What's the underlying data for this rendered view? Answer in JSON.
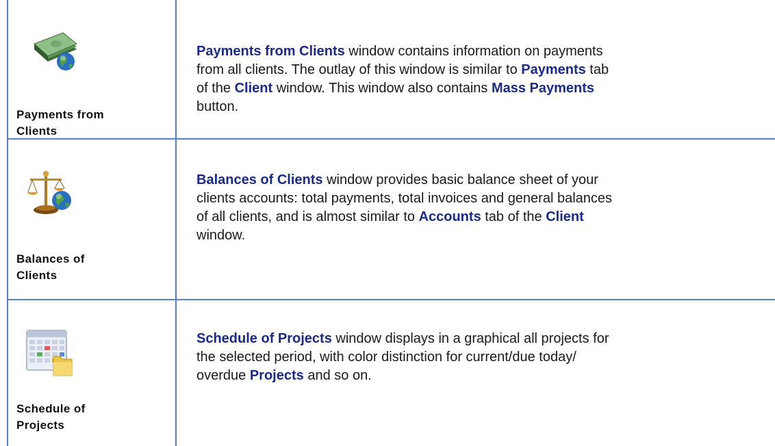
{
  "rows": [
    {
      "label_line1": "Payments from",
      "label_line2": "Clients",
      "icon": "money-globe-icon",
      "desc": {
        "t1": "Payments from Clients",
        "t2": " window contains information on payments",
        "t3": "from all clients. The outlay of this window is similar to ",
        "t4": "Payments",
        "t5": " tab",
        "t6": "of the ",
        "t7": "Client",
        "t8": " window. This window also contains ",
        "t9": "Mass Payments",
        "t10": "button."
      }
    },
    {
      "label_line1": "Balances of",
      "label_line2": "Clients",
      "icon": "scales-globe-icon",
      "desc": {
        "t1": "Balances of Clients",
        "t2": " window provides basic balance sheet of your",
        "t3": "clients accounts: total payments, total invoices and general balances",
        "t4": "of all clients, and is almost similar to ",
        "t5": "Accounts",
        "t6": " tab of the ",
        "t7": "Client",
        "t8": "window."
      }
    },
    {
      "label_line1": "Schedule of",
      "label_line2": "Projects",
      "icon": "calendar-folder-icon",
      "desc": {
        "t1": "Schedule of Projects",
        "t2": " window displays in a graphical all projects for",
        "t3": "the selected period, with color distinction for current/due today/",
        "t4": "overdue ",
        "t5": "Projects",
        "t6": " and so on."
      }
    }
  ],
  "colors": {
    "accent": "#1a2a8a",
    "border": "#5b7dc4"
  }
}
